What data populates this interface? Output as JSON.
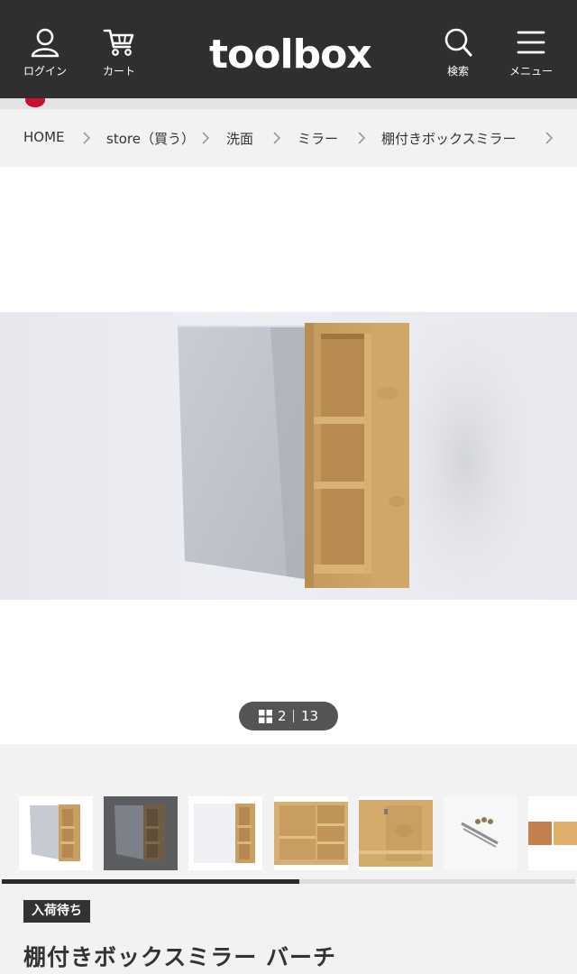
{
  "header": {
    "brand": "toolbox",
    "login_label": "ログイン",
    "cart_label": "カート",
    "search_label": "検索",
    "menu_label": "メニュー",
    "background_color": "#2f2f2f"
  },
  "breadcrumb": {
    "items": [
      "HOME",
      "store（買う）",
      "洗面",
      "ミラー",
      "棚付きボックスミラー"
    ]
  },
  "gallery": {
    "current": "2",
    "total": "13",
    "thumbnail_count": 7,
    "selected_thumbnail": 2,
    "scroll_position": 0.52
  },
  "product": {
    "status_badge": "入荷待ち",
    "title": "棚付きボックスミラー バーチ"
  },
  "colors": {
    "accent_red": "#c8102e",
    "wood": "#c9a064"
  }
}
